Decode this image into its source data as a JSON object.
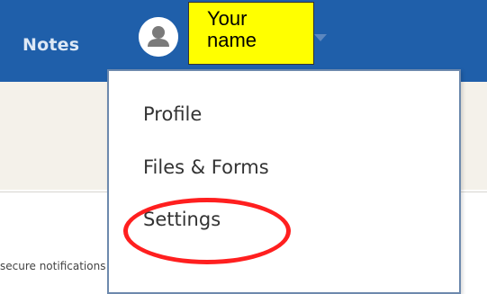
{
  "navbar": {
    "notes_label": "Notes",
    "avatar_icon": "user-avatar-icon",
    "caret_icon": "caret-down-icon",
    "background_color": "#1f5faa"
  },
  "annotation": {
    "name_line1": "Your",
    "name_line2": "name",
    "highlight_color": "#ff1f1f",
    "tag_color": "#ffff00"
  },
  "dropdown": {
    "items": [
      {
        "label": "Profile"
      },
      {
        "label": "Files & Forms"
      },
      {
        "label": "Settings"
      }
    ]
  },
  "background": {
    "clipped_text": "secure notifications"
  }
}
